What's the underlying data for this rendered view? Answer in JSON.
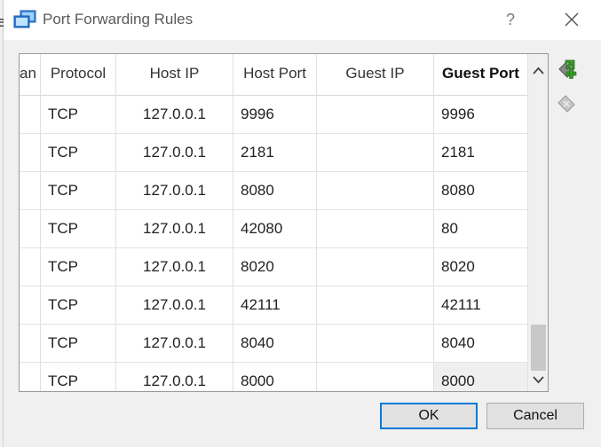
{
  "window": {
    "title": "Port Forwarding Rules",
    "help_glyph": "?",
    "left_fragment": "e"
  },
  "table": {
    "columns": [
      "an",
      "Protocol",
      "Host IP",
      "Host Port",
      "Guest IP",
      "Guest Port"
    ],
    "rows": [
      {
        "protocol": "TCP",
        "host_ip": "127.0.0.1",
        "host_port": "9996",
        "guest_ip": "",
        "guest_port": "9996"
      },
      {
        "protocol": "TCP",
        "host_ip": "127.0.0.1",
        "host_port": "2181",
        "guest_ip": "",
        "guest_port": "2181"
      },
      {
        "protocol": "TCP",
        "host_ip": "127.0.0.1",
        "host_port": "8080",
        "guest_ip": "",
        "guest_port": "8080"
      },
      {
        "protocol": "TCP",
        "host_ip": "127.0.0.1",
        "host_port": "42080",
        "guest_ip": "",
        "guest_port": "80"
      },
      {
        "protocol": "TCP",
        "host_ip": "127.0.0.1",
        "host_port": "8020",
        "guest_ip": "",
        "guest_port": "8020"
      },
      {
        "protocol": "TCP",
        "host_ip": "127.0.0.1",
        "host_port": "42111",
        "guest_ip": "",
        "guest_port": "42111"
      },
      {
        "protocol": "TCP",
        "host_ip": "127.0.0.1",
        "host_port": "8040",
        "guest_ip": "",
        "guest_port": "8040"
      },
      {
        "protocol": "TCP",
        "host_ip": "127.0.0.1",
        "host_port": "8000",
        "guest_ip": "",
        "guest_port": "8000"
      }
    ],
    "selected_cell": {
      "row": 7,
      "column": "Guest Port"
    },
    "scroll_position": "bottom"
  },
  "side_buttons": {
    "add_icon": "add-rule-icon",
    "remove_icon": "remove-rule-icon",
    "add_color": "#3a9a2a",
    "remove_color": "#b0b0b0"
  },
  "buttons": {
    "ok": "OK",
    "cancel": "Cancel"
  },
  "colors": {
    "accent": "#0078d7",
    "dialog_bg": "#f0f0f0"
  }
}
